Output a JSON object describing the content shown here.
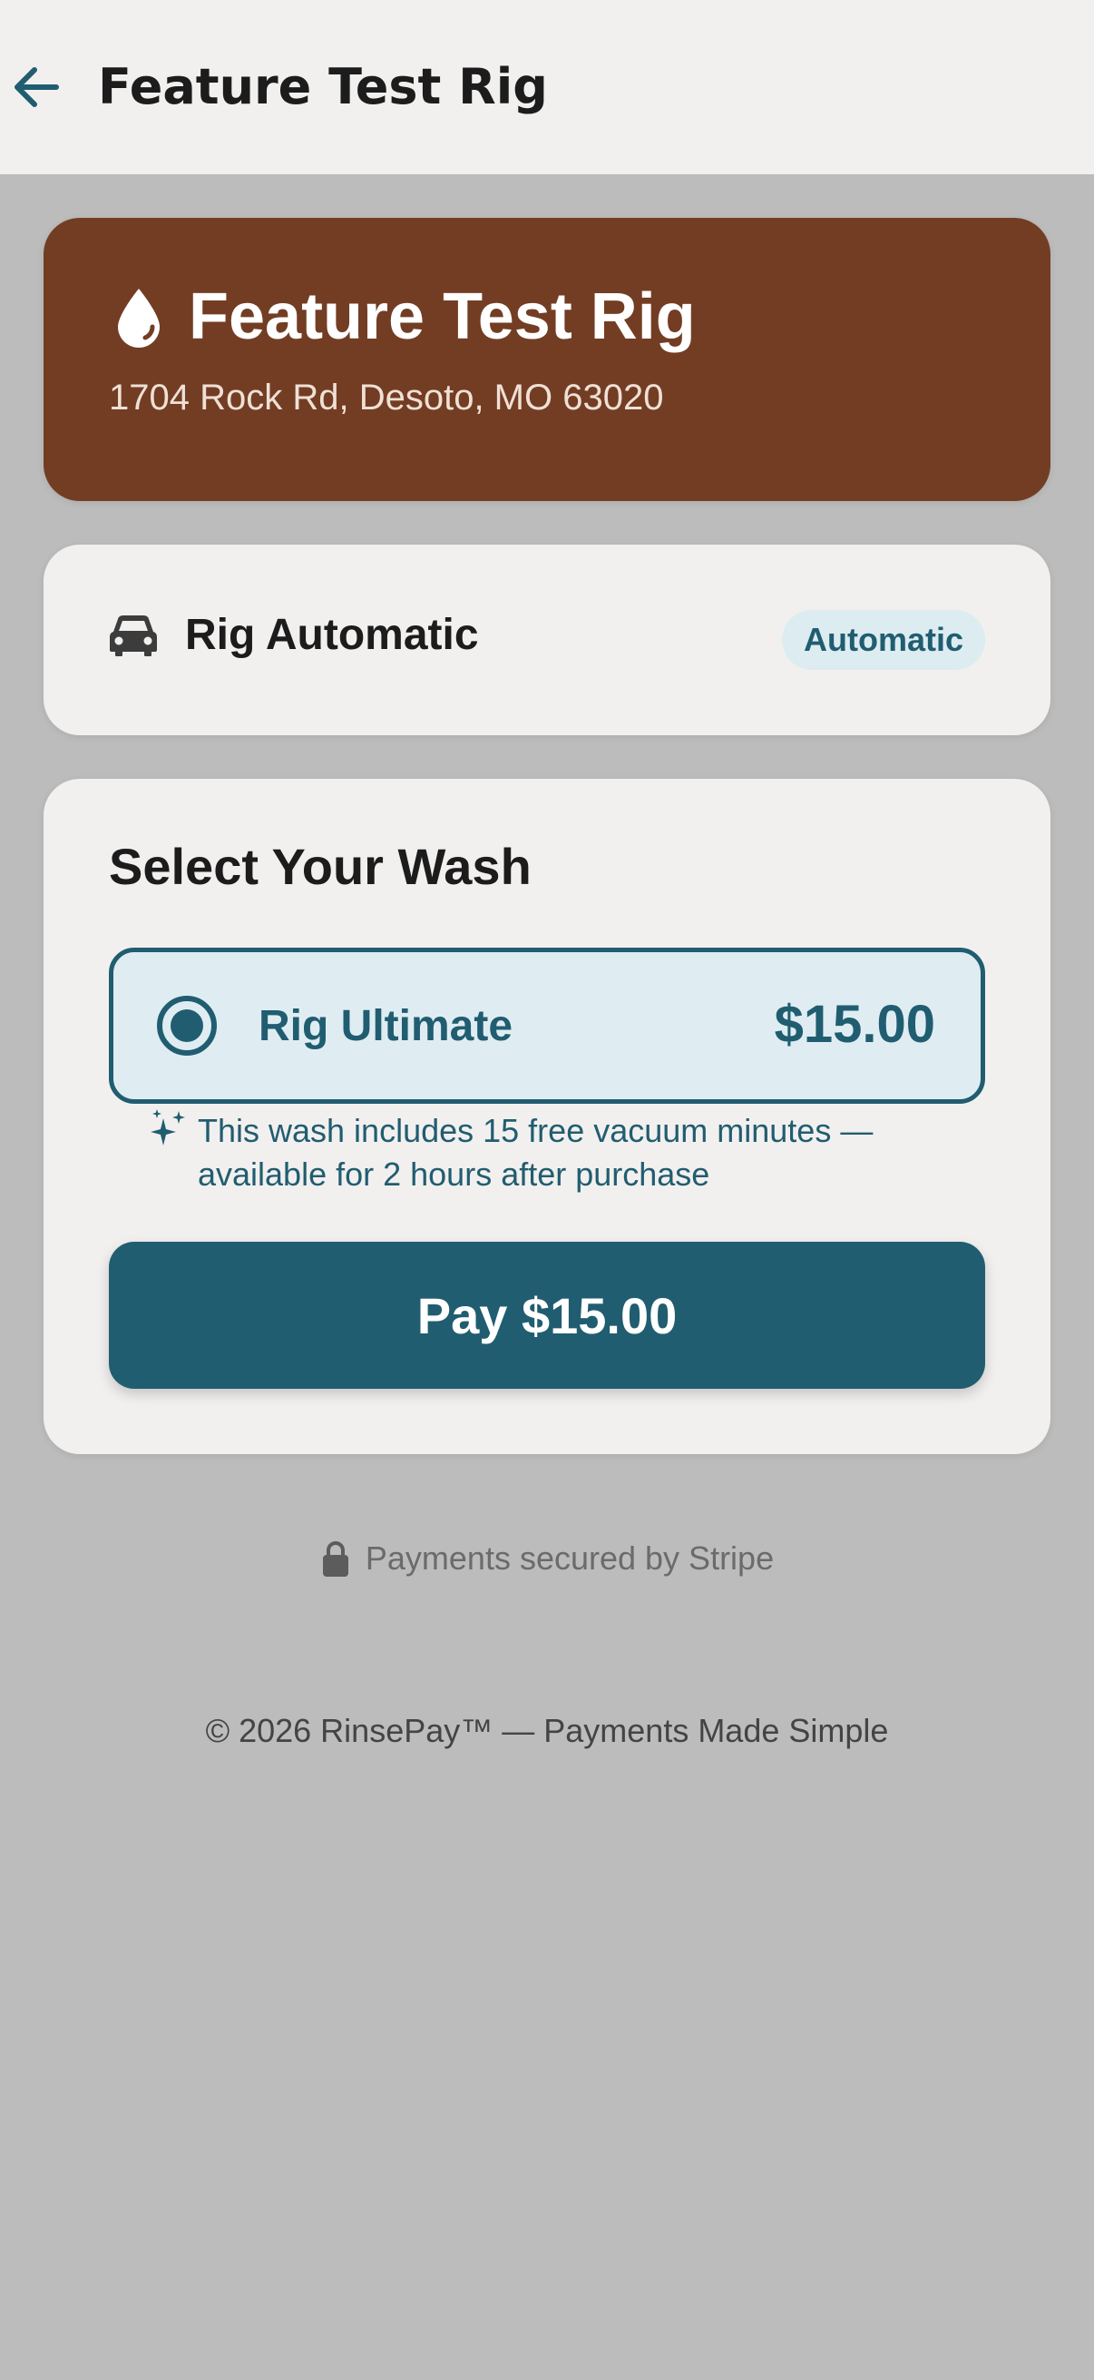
{
  "appbar": {
    "title": "Feature Test Rig",
    "back_icon": "arrow-left-icon"
  },
  "location": {
    "name": "Feature Test Rig",
    "address": "1704 Rock Rd, Desoto, MO 63020",
    "icon": "water-drop-icon"
  },
  "machine": {
    "name": "Rig Automatic",
    "type_badge": "Automatic",
    "icon": "car-icon"
  },
  "wash": {
    "section_title": "Select Your Wash",
    "options": [
      {
        "name": "Rig Ultimate",
        "price": "$15.00",
        "selected": true
      }
    ],
    "note": "This wash includes 15 free vacuum minutes — available for 2 hours after purchase",
    "note_icon": "sparkles-icon",
    "pay_label": "Pay $15.00"
  },
  "security": {
    "text": "Payments secured by Stripe",
    "icon": "lock-icon"
  },
  "footer": {
    "text": "© 2026 RinsePay™ — Payments Made Simple"
  },
  "colors": {
    "primary": "#215d70",
    "hero_bg": "#733d24",
    "page_bg": "#bbbcbb",
    "card_bg": "#f2f0ef",
    "badge_bg": "#dcecf1"
  }
}
